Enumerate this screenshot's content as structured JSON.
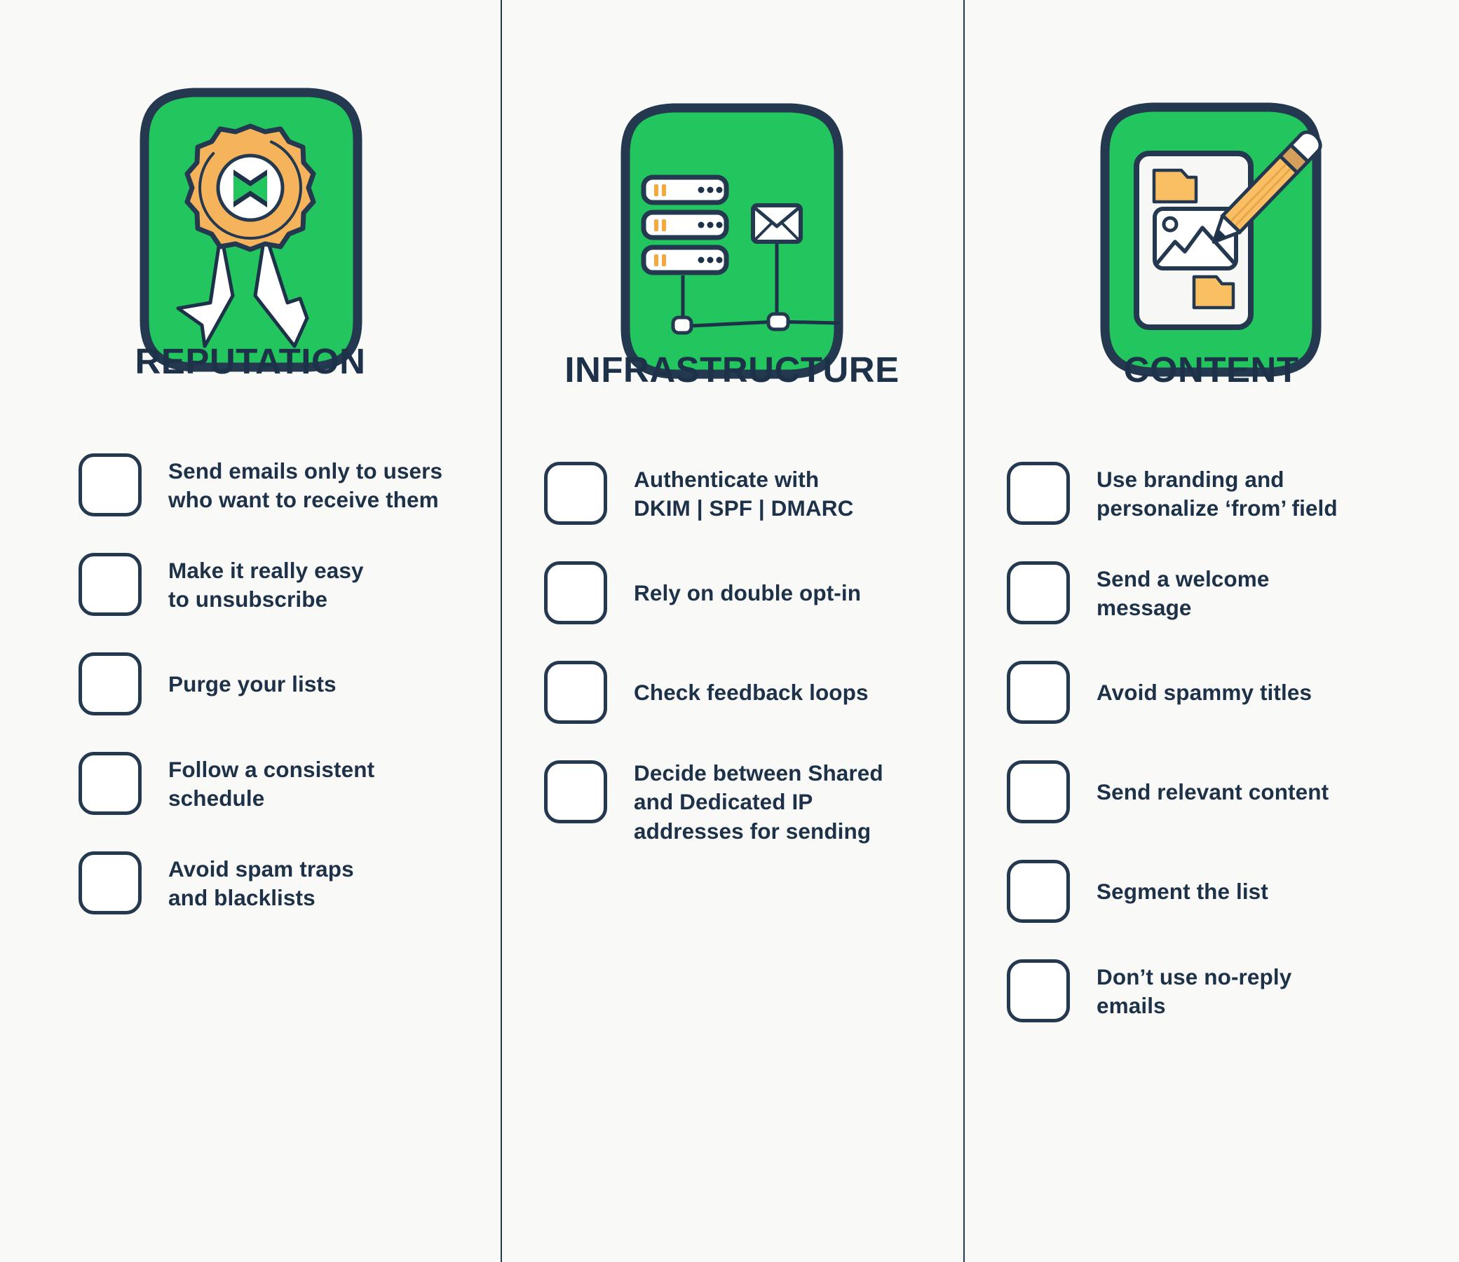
{
  "theme": {
    "background": "#f9f9f7",
    "ink": "#1d3148",
    "outline": "#24384f",
    "green": "#22c55e",
    "green_alt": "#1fbf5c",
    "orange": "#f8b04e",
    "orange_light": "#fbbf63",
    "white": "#ffffff",
    "panel_white": "#f7f7f5"
  },
  "columns": [
    {
      "id": "reputation",
      "title": "REPUTATION",
      "icon": "award-ribbon-badge-icon",
      "items": [
        {
          "label": "Send emails only to users\nwho want to receive them"
        },
        {
          "label": "Make it really easy\nto unsubscribe"
        },
        {
          "label": "Purge your lists"
        },
        {
          "label": "Follow a consistent\nschedule"
        },
        {
          "label": "Avoid spam traps\nand blacklists"
        }
      ]
    },
    {
      "id": "infrastructure",
      "title": "INFRASTRUCTURE",
      "icon": "server-stack-envelope-network-icon",
      "items": [
        {
          "label": "Authenticate with\nDKIM | SPF | DMARC"
        },
        {
          "label": "Rely on double opt-in"
        },
        {
          "label": "Check feedback loops"
        },
        {
          "label": "Decide between Shared\nand Dedicated IP\naddresses for sending"
        }
      ]
    },
    {
      "id": "content",
      "title": "CONTENT",
      "icon": "document-image-pencil-icon",
      "items": [
        {
          "label": "Use branding and\npersonalize ‘from’ field"
        },
        {
          "label": "Send a welcome\nmessage"
        },
        {
          "label": "Avoid spammy titles"
        },
        {
          "label": "Send relevant content"
        },
        {
          "label": "Segment the list"
        },
        {
          "label": "Don’t use no-reply\nemails"
        }
      ]
    }
  ]
}
